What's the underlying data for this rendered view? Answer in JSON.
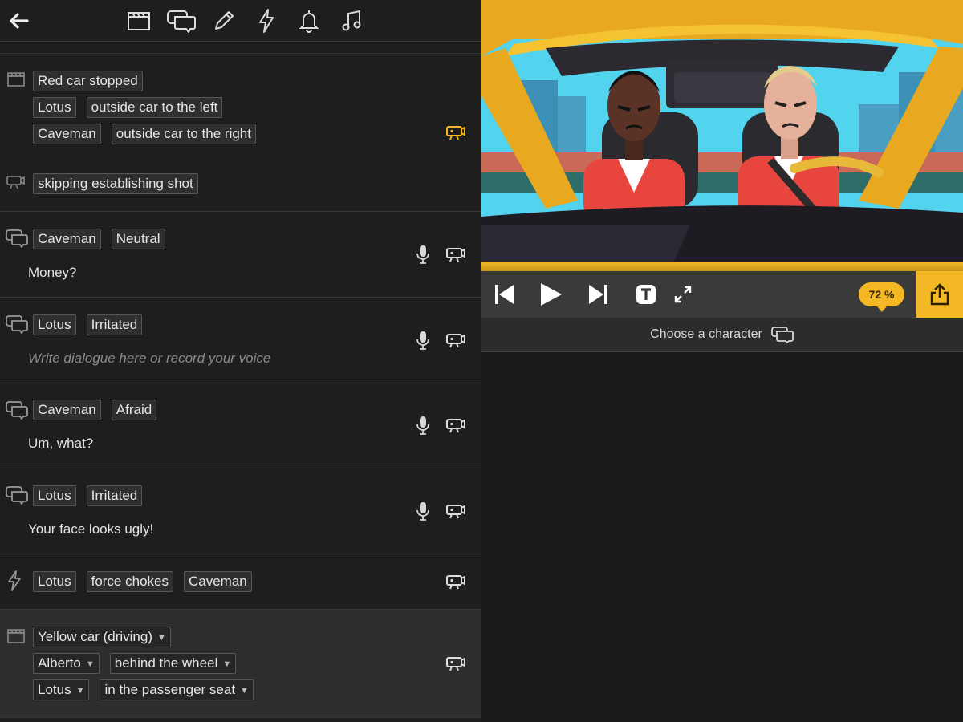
{
  "toolbar": {
    "icons": [
      "back-arrow-icon",
      "clapperboard-icon",
      "dialogue-icon",
      "pencil-icon",
      "lightning-icon",
      "bell-icon",
      "music-icon"
    ]
  },
  "scene1": {
    "location": "Red car stopped",
    "row2": [
      "Lotus",
      "outside car to the left"
    ],
    "row3": [
      "Caveman",
      "outside car to the right"
    ],
    "camera_note": "skipping establishing shot"
  },
  "dialogues": [
    {
      "character": "Caveman",
      "emotion": "Neutral",
      "text": "Money?"
    },
    {
      "character": "Lotus",
      "emotion": "Irritated",
      "text": "",
      "placeholder": "Write dialogue here or record your voice"
    },
    {
      "character": "Caveman",
      "emotion": "Afraid",
      "text": "Um, what?"
    },
    {
      "character": "Lotus",
      "emotion": "Irritated",
      "text": "Your face looks ugly!"
    }
  ],
  "action": {
    "actor": "Lotus",
    "verb": "force chokes",
    "target": "Caveman"
  },
  "scene2": {
    "location": "Yellow car (driving)",
    "row2": [
      "Alberto",
      "behind the wheel"
    ],
    "row3": [
      "Lotus",
      "in the passenger seat"
    ]
  },
  "player": {
    "zoom": "72 %",
    "choose_character": "Choose a character",
    "accent_color": "#f3b824"
  }
}
